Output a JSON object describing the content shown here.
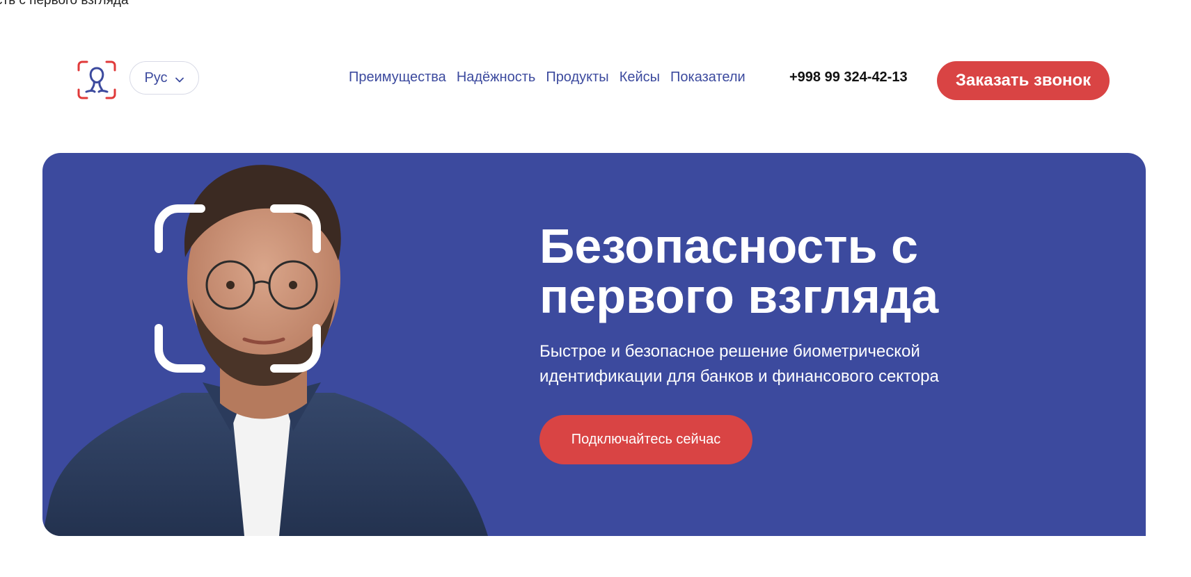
{
  "top_fragment": "сть с первого взгляда",
  "header": {
    "logo_icon": "face-id-logo-icon",
    "language": {
      "selected": "Рус"
    },
    "nav": [
      {
        "label": "Преимущества"
      },
      {
        "label": "Надёжность"
      },
      {
        "label": "Продукты"
      },
      {
        "label": "Кейсы"
      },
      {
        "label": "Показатели"
      }
    ],
    "phone": "+998 99 324-42-13",
    "call_button": "Заказать звонок"
  },
  "hero": {
    "title_line1": "Безопасность с",
    "title_line2": "первого взгляда",
    "subtitle_line1": "Быстрое и безопасное решение биометрической",
    "subtitle_line2": "идентификации для банков и финансового сектора",
    "cta_button": "Подключайтесь сейчас"
  },
  "colors": {
    "brand_blue": "#3c4a9e",
    "accent_red": "#d94444",
    "nav_text": "#3c4a9e"
  }
}
